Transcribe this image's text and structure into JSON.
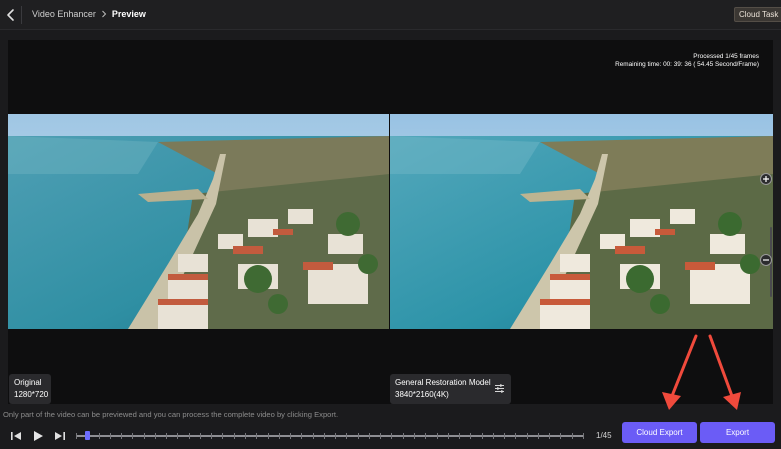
{
  "header": {
    "breadcrumb": [
      "Video Enhancer",
      "Preview"
    ],
    "cloud_task_label": "Cloud Task"
  },
  "preview": {
    "processed_text": "Processed 1/45 frames",
    "remaining_text": "Remaining time: 00: 39: 36 ( 54.45 Second/Frame)",
    "original": {
      "title": "Original",
      "resolution": "1280*720"
    },
    "enhanced": {
      "title": "General Restoration Model",
      "resolution": "3840*2160(4K)"
    }
  },
  "footer": {
    "hint": "Only part of the video can be previewed and you can process the complete video by clicking Export.",
    "frame_counter": "1/45",
    "progress_fraction": 0.022,
    "cloud_export_label": "Cloud Export",
    "export_label": "Export"
  },
  "colors": {
    "accent": "#6b5cf6",
    "annotation_arrow": "#f04a3c"
  },
  "icons": [
    "chevron-left-icon",
    "chevron-right-icon",
    "zoom-in-icon",
    "zoom-out-icon",
    "sliders-icon",
    "previous-frame-icon",
    "play-icon",
    "next-frame-icon"
  ]
}
